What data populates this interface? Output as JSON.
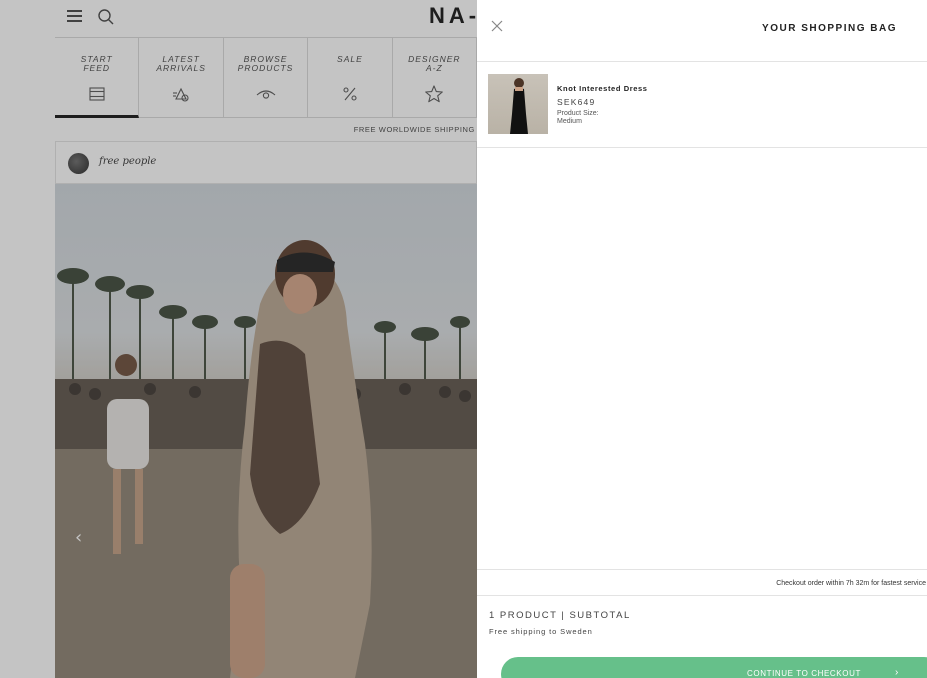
{
  "colors": {
    "accent": "#66c08a",
    "text": "#222222",
    "divider": "#e3e3e3",
    "overlay": "rgba(60,60,60,0.30)"
  },
  "site": {
    "logo": "NA-",
    "header_icons": [
      "menu-icon",
      "search-icon"
    ],
    "nav": [
      {
        "label": "START\nFEED",
        "icon": "feed-icon",
        "active": true
      },
      {
        "label": "LATEST\nARRIVALS",
        "icon": "arrivals-icon",
        "active": false
      },
      {
        "label": "BROWSE\nPRODUCTS",
        "icon": "eye-icon",
        "active": false
      },
      {
        "label": "SALE",
        "icon": "percent-icon",
        "active": false
      },
      {
        "label": "DESIGNER\nA-Z",
        "icon": "star-icon",
        "active": false
      }
    ],
    "shipping_bar": "FREE WORLDWIDE SHIPPING",
    "feed_post": {
      "brand": "free people",
      "nav_arrow": "‹"
    }
  },
  "bag": {
    "title": "YOUR SHOPPING BAG",
    "close_icon": "close-icon",
    "items": [
      {
        "name": "Knot Interested Dress",
        "price": "SEK649",
        "size_label": "Product Size:",
        "size_value": "Medium"
      }
    ],
    "checkout_note": "Checkout order within 7h 32m for fastest service",
    "summary": "1 PRODUCT | SUBTOTAL",
    "shipping_note": "Free shipping to Sweden",
    "checkout_button": "CONTINUE TO CHECKOUT",
    "checkout_chevron": "›"
  }
}
